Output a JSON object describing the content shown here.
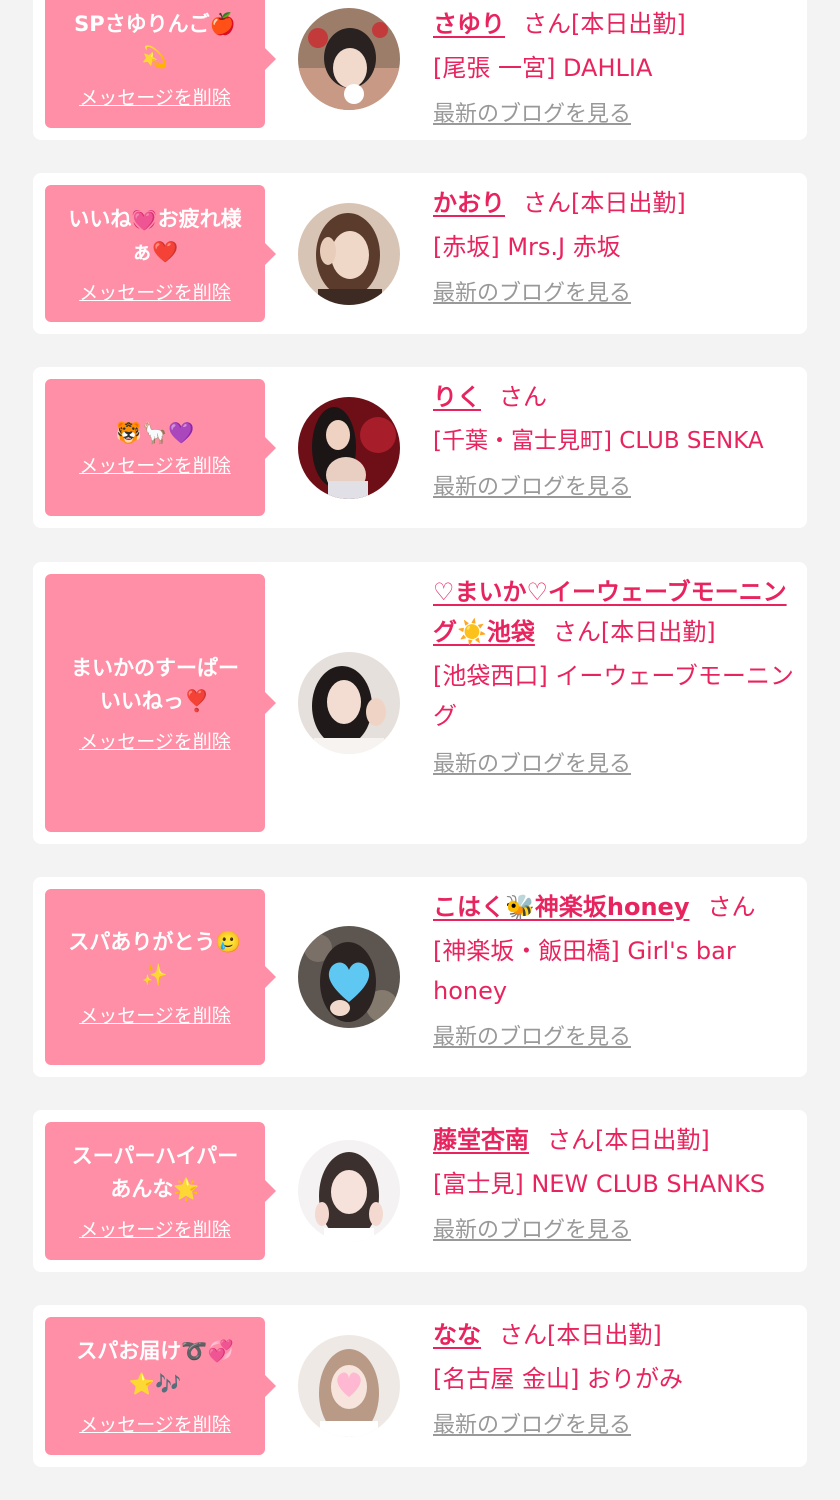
{
  "delete_label": "メッセージを削除",
  "blog_label": "最新のブログを見る",
  "colors": {
    "accent": "#e8245f",
    "bubble": "#ff8fa6",
    "link_gray": "#999999",
    "background": "#f3f3f3",
    "card": "#ffffff"
  },
  "entries": [
    {
      "message_line1": "SPさゆりんご🍎",
      "message_line2": "💫",
      "name": "さゆり",
      "suffix": "さん[本日出勤]",
      "shop": "[尾張 一宮] DAHLIA"
    },
    {
      "message_line1": "いいね💓お疲れ様",
      "message_line2": "ぁ❤️",
      "name": "かおり",
      "suffix": "さん[本日出勤]",
      "shop": "[赤坂] Mrs.J 赤坂"
    },
    {
      "message_line1": "🐯🦙💜",
      "message_line2": "",
      "name": "りく",
      "suffix": "さん",
      "shop": "[千葉・富士見町] CLUB SENKA"
    },
    {
      "message_line1": "まいかのすーぱー",
      "message_line2": "いいねっ❣️",
      "name": "♡まいか♡イーウェーブモーニング☀️池袋",
      "suffix": "さん[本日出勤]",
      "shop": "[池袋西口] イーウェーブモーニング"
    },
    {
      "message_line1": "スパありがとう🥲",
      "message_line2": "✨",
      "name": "こはく🐝神楽坂honey",
      "suffix": "さん",
      "shop": "[神楽坂・飯田橋] Girl's bar honey"
    },
    {
      "message_line1": "スーパーハイパー",
      "message_line2": "あんな🌟",
      "name": "藤堂杏南",
      "suffix": "さん[本日出勤]",
      "shop": "[富士見] NEW CLUB SHANKS"
    },
    {
      "message_line1": "スパお届け➰💞",
      "message_line2": "⭐🎶",
      "name": "なな",
      "suffix": "さん[本日出勤]",
      "shop": "[名古屋 金山] おりがみ"
    }
  ]
}
